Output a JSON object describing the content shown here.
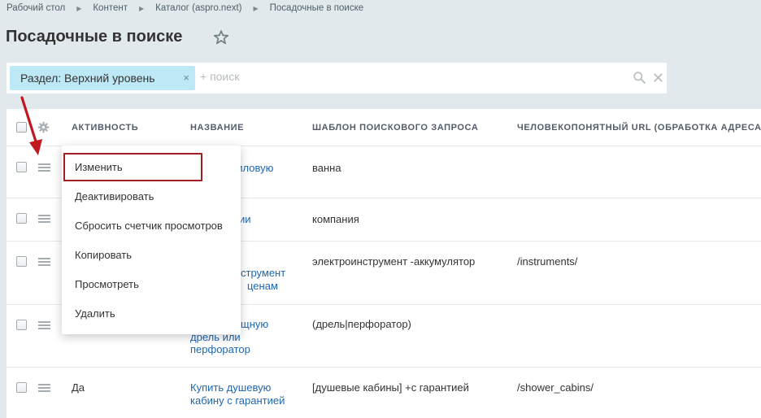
{
  "breadcrumb": [
    "Рабочий стол",
    "Контент",
    "Каталог (aspro.next)",
    "Посадочные в поиске"
  ],
  "page_title": "Посадочные в поиске",
  "filter": {
    "tag_label": "Раздел: Верхний уровень",
    "tag_close": "×",
    "search_placeholder": "+ поиск"
  },
  "table": {
    "columns": [
      "АКТИВНОСТЬ",
      "НАЗВАНИЕ",
      "ШАБЛОН ПОИСКОВОГО ЗАПРОСА",
      "ЧЕЛОВЕКОПОНЯТНЫЙ URL (ОБРАБОТКА АДРЕСА)"
    ],
    "rows": [
      {
        "active": "",
        "name": [
          "риловую"
        ],
        "template": "ванна",
        "url": ""
      },
      {
        "active": "",
        "name": [
          "ии"
        ],
        "template": "компания",
        "url": ""
      },
      {
        "active": "",
        "name": [
          "струмент",
          "ценам"
        ],
        "template": "электроинструмент -аккумулятор",
        "url": "/instruments/"
      },
      {
        "active": "",
        "name": [
          "щную",
          "дрель или",
          "перфоратор"
        ],
        "template": "(дрель|перфоратор)",
        "url": ""
      },
      {
        "active": "Да",
        "name": [
          "Купить душевую",
          "кабину с гарантией"
        ],
        "template": "[душевые кабины] +с гарантией",
        "url": "/shower_cabins/"
      }
    ]
  },
  "context_menu": {
    "items": [
      "Изменить",
      "Деактивировать",
      "Сбросить счетчик просмотров",
      "Копировать",
      "Просмотреть",
      "Удалить"
    ],
    "highlighted_index": 0
  },
  "colors": {
    "background": "#e1e9ec",
    "filter_tag": "#bde8f6",
    "link": "#2067b0",
    "highlight_border": "#a11f24",
    "arrow": "#c0181f"
  },
  "icons": {
    "star": "star-icon",
    "search": "search-icon",
    "clear": "close-icon",
    "settings": "gear-icon",
    "row_menu": "hamburger-icon",
    "pointer": "arrow-icon"
  }
}
